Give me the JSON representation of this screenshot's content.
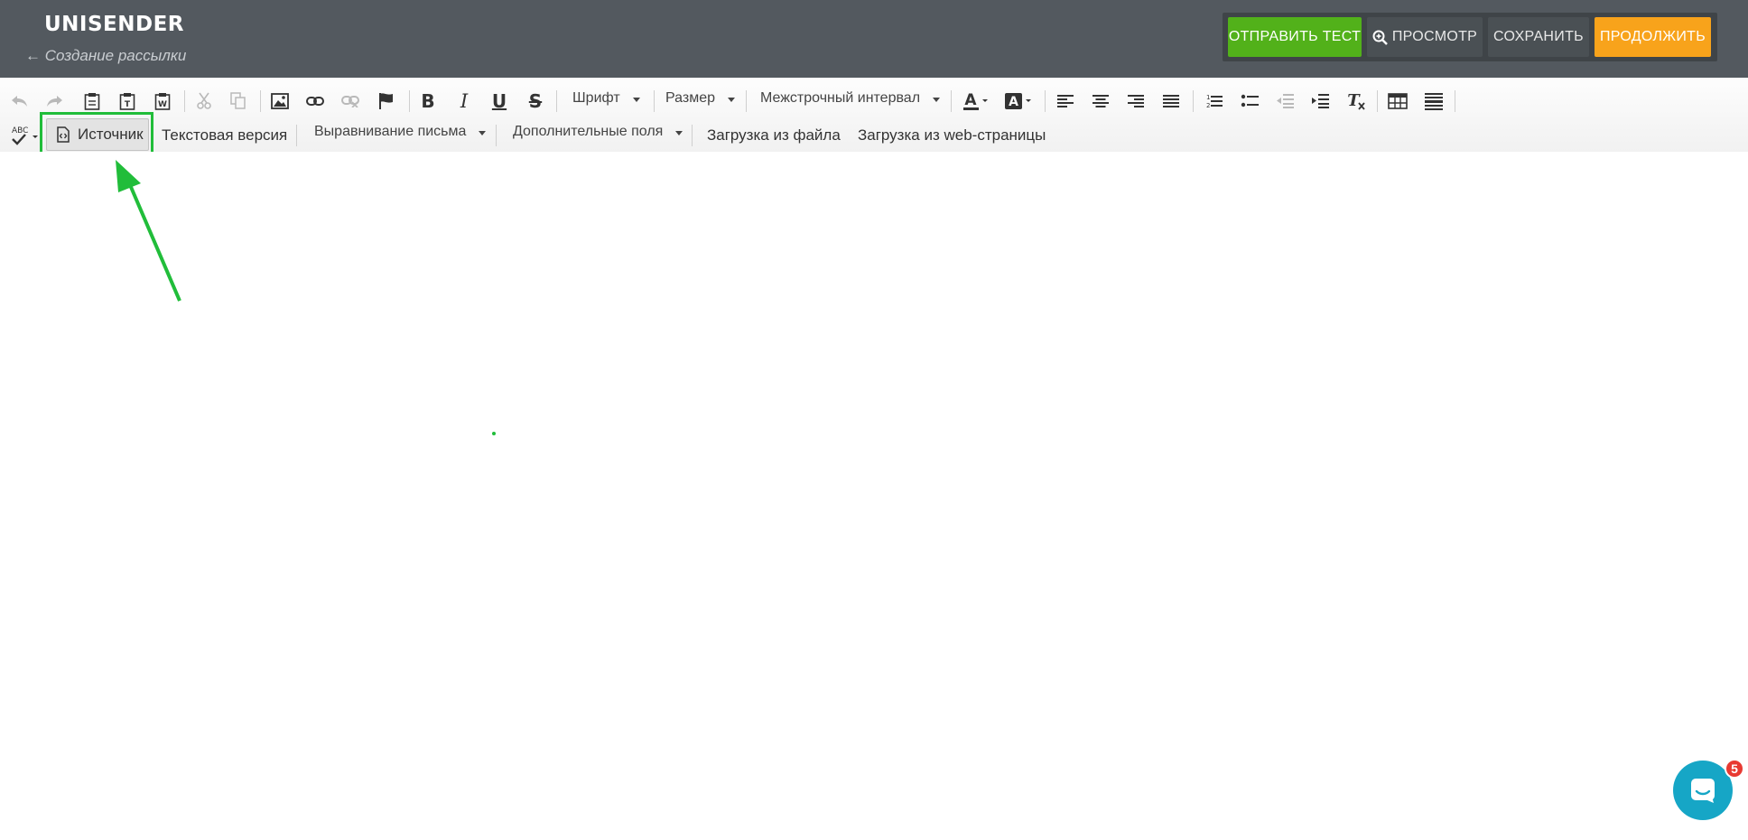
{
  "header": {
    "logo": "UNISENDER",
    "back_link": "← Создание рассылки",
    "buttons": {
      "send_test": "ОТПРАВИТЬ ТЕСТ",
      "preview": "ПРОСМОТР",
      "save": "СОХРАНИТЬ",
      "continue": "ПРОДОЛЖИТЬ"
    }
  },
  "toolbar": {
    "font": "Шрифт",
    "size": "Размер",
    "line_spacing": "Межстрочный интервал",
    "spellcheck": "ABC",
    "source": "Источник",
    "text_version": "Текстовая версия",
    "letter_align": "Выравнивание письма",
    "extra_fields": "Дополнительные поля",
    "load_file": "Загрузка из файла",
    "load_web": "Загрузка из web-страницы"
  },
  "chat": {
    "badge_count": "5"
  },
  "colors": {
    "header_bg": "#53595f",
    "send_test": "#52b11a",
    "continue": "#f8a31b",
    "highlight": "#21bd3a",
    "chat": "#16a6c6",
    "badge": "#e83a32"
  }
}
